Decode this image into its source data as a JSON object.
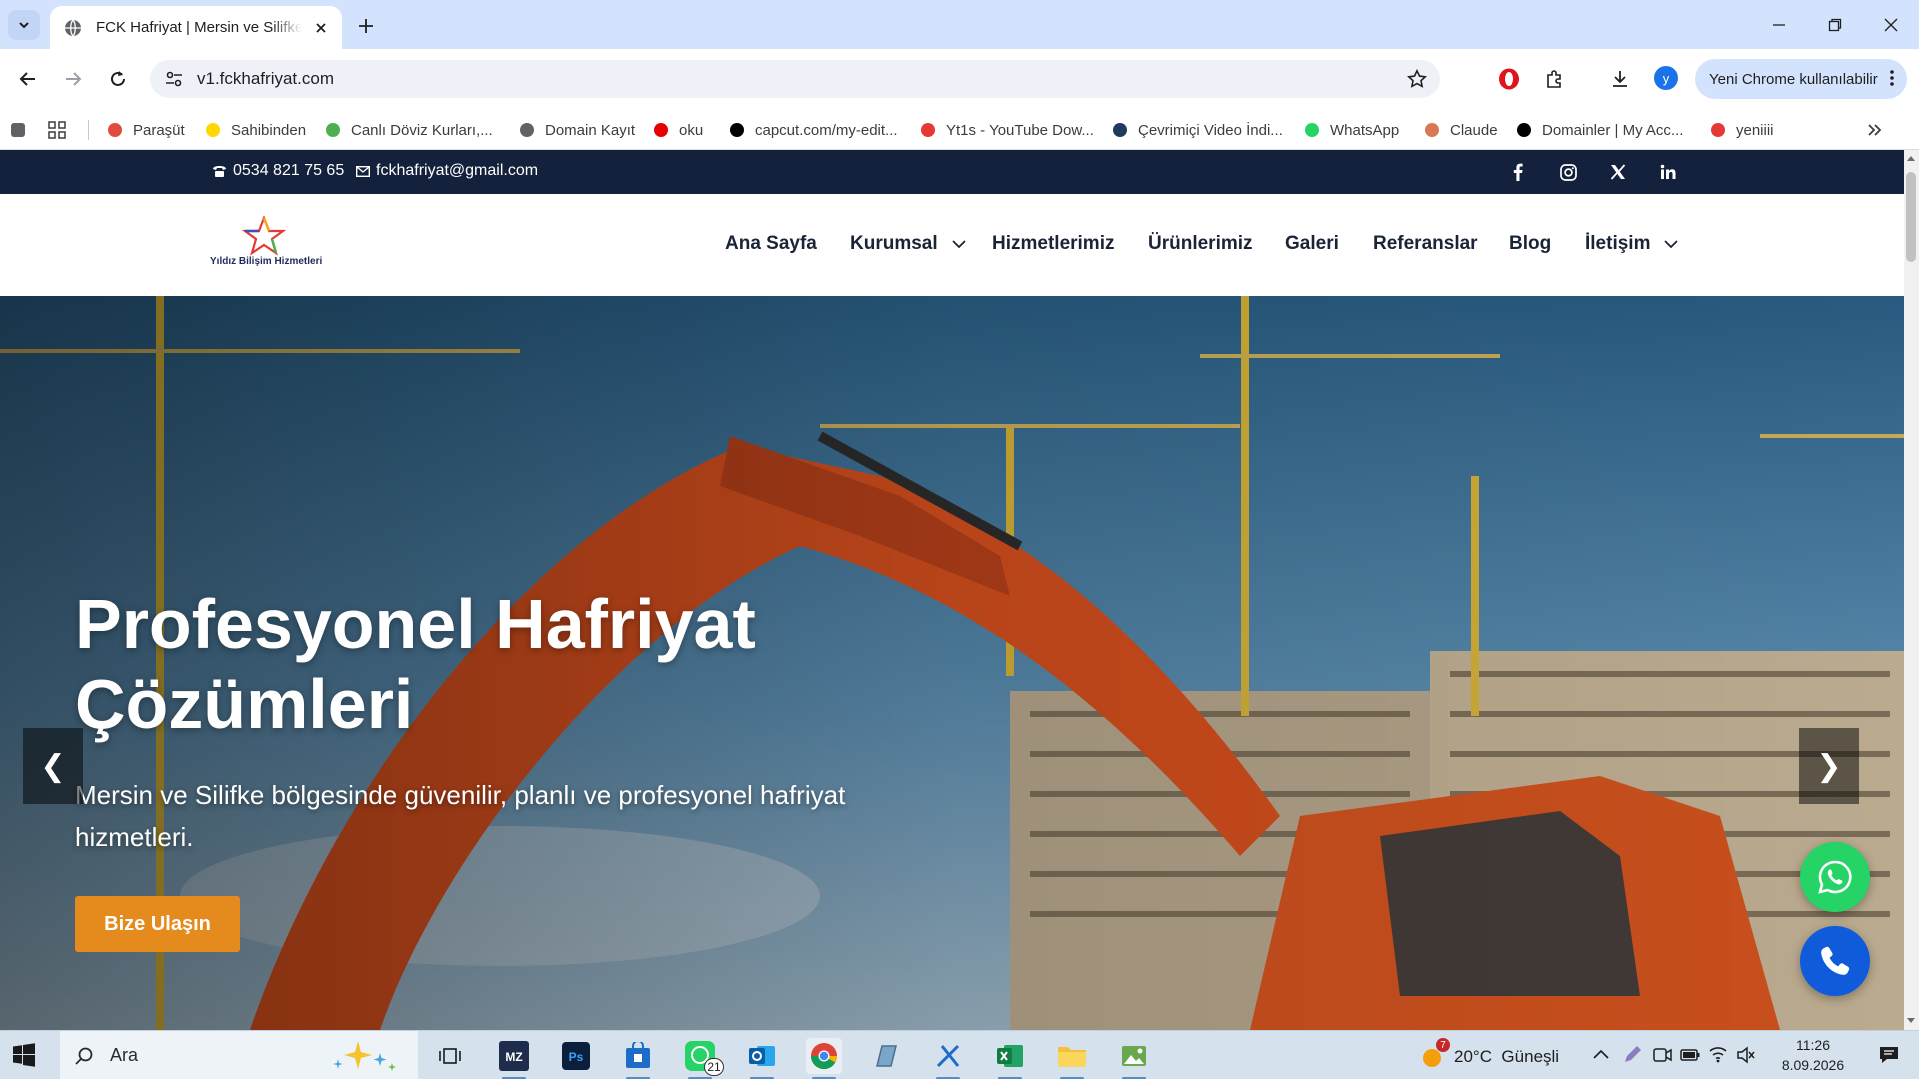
{
  "browser": {
    "tab_title": "FCK Hafriyat | Mersin ve Silifke Hafriyat",
    "url": "v1.fckhafriyat.com",
    "update_label": "Yeni Chrome kullanılabilir",
    "profile_initial": "y"
  },
  "bookmarks": [
    {
      "label": "Paraşüt",
      "icon": "parasut-icon",
      "color": "#e04a3f"
    },
    {
      "label": "Sahibinden",
      "icon": "sahibinden-icon",
      "color": "#ffd800"
    },
    {
      "label": "Canlı Döviz Kurları,...",
      "icon": "doviz-icon",
      "color": "#4caf50"
    },
    {
      "label": "Domain Kayıt",
      "icon": "globe-icon",
      "color": "#5f6368"
    },
    {
      "label": "oku",
      "icon": "vodafone-icon",
      "color": "#e60000"
    },
    {
      "label": "capcut.com/my-edit...",
      "icon": "capcut-icon",
      "color": "#000000"
    },
    {
      "label": "Yt1s - YouTube Dow...",
      "icon": "yt1s-icon",
      "color": "#e53935"
    },
    {
      "label": "Çevrimiçi Video İndi...",
      "icon": "video-download-icon",
      "color": "#1e3a5f"
    },
    {
      "label": "WhatsApp",
      "icon": "whatsapp-icon",
      "color": "#25d366"
    },
    {
      "label": "Claude",
      "icon": "claude-icon",
      "color": "#d97757"
    },
    {
      "label": "Domainler | My Acc...",
      "icon": "wix-icon",
      "color": "#000000"
    },
    {
      "label": "yeniiii",
      "icon": "youtube-icon",
      "color": "#e53935"
    }
  ],
  "site": {
    "topbar": {
      "phone": "0534 821 75 65",
      "email": "fckhafriyat@gmail.com",
      "socials": [
        "facebook-icon",
        "instagram-icon",
        "x-icon",
        "linkedin-icon"
      ]
    },
    "logo_text": "Yıldız Bilişim Hizmetleri",
    "nav": {
      "home": "Ana Sayfa",
      "corporate": "Kurumsal",
      "services": "Hizmetlerimiz",
      "products": "Ürünlerimiz",
      "gallery": "Galeri",
      "references": "Referanslar",
      "blog": "Blog",
      "contact": "İletişim"
    },
    "hero": {
      "title": "Profesyonel Hafriyat Çözümleri",
      "subtitle": "Mersin ve Silifke bölgesinde güvenilir, planlı ve profesyonel hafriyat hizmetleri.",
      "cta": "Bize Ulaşın",
      "prev": "❮",
      "next": "❯"
    },
    "colors": {
      "topbar": "#14213d",
      "accent": "#e58a1d",
      "whatsapp": "#25d366",
      "call": "#0f5bd9"
    }
  },
  "taskbar": {
    "search_placeholder": "Ara",
    "whatsapp_badge": "21",
    "weather": "20°C  Güneşli",
    "weather_badge": "7",
    "time": "11:26",
    "date": "8.09.2026"
  }
}
